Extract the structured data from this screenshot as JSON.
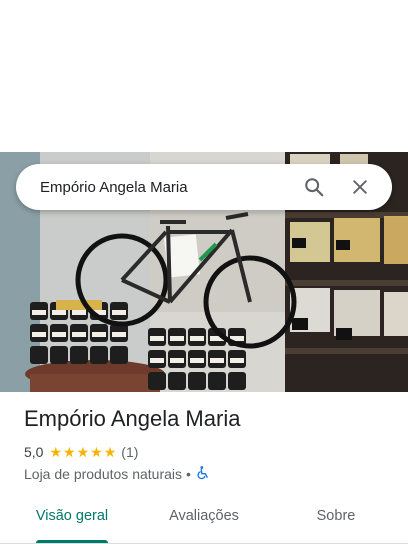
{
  "search": {
    "query": "Empório Angela Maria",
    "search_icon": "search-icon",
    "close_icon": "close-icon"
  },
  "place": {
    "name": "Empório Angela Maria",
    "rating": "5,0",
    "stars_filled": 5,
    "review_count": "(1)",
    "category": "Loja de produtos naturais",
    "separator": "•",
    "accessibility_icon": "wheelchair-icon",
    "photo": "store-interior-photo"
  },
  "tabs": [
    {
      "label": "Visão geral",
      "active": true
    },
    {
      "label": "Avaliações",
      "active": false
    },
    {
      "label": "Sobre",
      "active": false
    }
  ],
  "colors": {
    "accent": "#00796b",
    "star": "#f4b400",
    "text_primary": "#202124",
    "text_secondary": "#5f6368"
  }
}
